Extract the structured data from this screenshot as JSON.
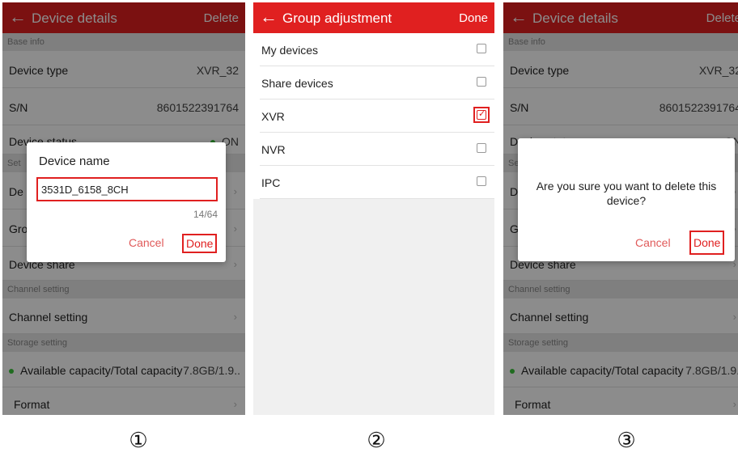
{
  "screens": [
    {
      "label": "①",
      "header": {
        "title": "Device details",
        "right_label": "Delete"
      },
      "sections": {
        "base_info": "Base info",
        "setting": "Set",
        "channel": "Channel setting",
        "storage": "Storage setting"
      },
      "rows": {
        "device_type": {
          "label": "Device type",
          "value": "XVR_32"
        },
        "sn": {
          "label": "S/N",
          "value": "8601522391764"
        },
        "device_status": {
          "label": "Device status",
          "value": "ON"
        },
        "device_name": {
          "label": "De"
        },
        "group": {
          "label": "Gro"
        },
        "device_share": {
          "label": "Device share"
        },
        "channel_setting": {
          "label": "Channel setting"
        },
        "capacity": {
          "label": "Available capacity/Total capacity",
          "value": "7.8GB/1.9.."
        },
        "format": {
          "label": "Format"
        }
      },
      "dialog": {
        "title": "Device name",
        "input_value": "3531D_6158_8CH",
        "counter": "14/64",
        "cancel": "Cancel",
        "done": "Done"
      }
    },
    {
      "label": "②",
      "header": {
        "title": "Group adjustment",
        "right_label": "Done"
      },
      "items": [
        {
          "label": "My devices",
          "checked": false
        },
        {
          "label": "Share devices",
          "checked": false
        },
        {
          "label": "XVR",
          "checked": true
        },
        {
          "label": "NVR",
          "checked": false
        },
        {
          "label": "IPC",
          "checked": false
        }
      ]
    },
    {
      "label": "③",
      "header": {
        "title": "Device details",
        "right_label": "Delete"
      },
      "sections": {
        "base_info": "Base info",
        "setting": "Se",
        "channel": "Channel setting",
        "storage": "Storage setting"
      },
      "rows": {
        "device_type": {
          "label": "Device type",
          "value": "XVR_32"
        },
        "sn": {
          "label": "S/N",
          "value": "8601522391764"
        },
        "device_status": {
          "label": "Device status",
          "value": "ON"
        },
        "device_name": {
          "label": "D"
        },
        "group": {
          "label": "G"
        },
        "device_share": {
          "label": "Device share"
        },
        "channel_setting": {
          "label": "Channel setting"
        },
        "capacity": {
          "label": "Available capacity/Total capacity",
          "value": "7.8GB/1.9.."
        },
        "format": {
          "label": "Format"
        }
      },
      "dialog": {
        "message": "Are you sure you want to delete this device?",
        "cancel": "Cancel",
        "done": "Done"
      }
    }
  ],
  "colors": {
    "accent": "#e02020",
    "status_on": "#3bc43b"
  }
}
